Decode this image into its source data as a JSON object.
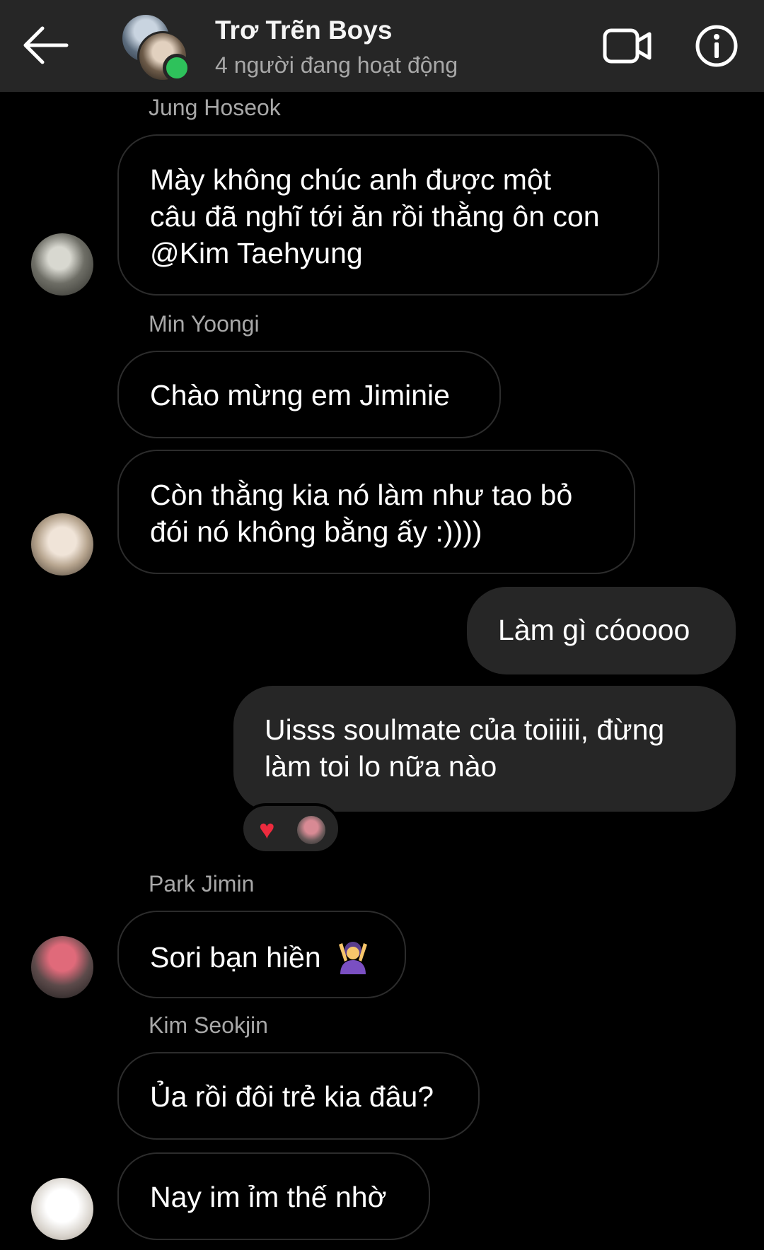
{
  "header": {
    "group_name": "Trơ Trẽn Boys",
    "status": "4 người đang hoạt động"
  },
  "messages": [
    {
      "sender": "Jung Hoseok",
      "text": "Mày không chúc anh được một\ncâu đã nghĩ tới ăn rồi thằng ôn con\n@Kim Taehyung"
    },
    {
      "sender": "Min Yoongi",
      "text": "Chào mừng em Jiminie"
    },
    {
      "text": "Còn thằng kia nó làm như tao bỏ\nđói nó không bằng ấy :))))"
    },
    {
      "text": "Làm gì cóoooo"
    },
    {
      "text": "Uisss soulmate của toiiiii, đừng\nlàm toi lo nữa nào",
      "reactions": [
        "heart"
      ]
    },
    {
      "sender": "Park Jimin",
      "text": "Sori bạn hiền",
      "emoji": "woman-raising-hand-emoji"
    },
    {
      "sender": "Kim Seokjin",
      "text": "Ủa rồi đôi trẻ kia đâu?"
    },
    {
      "text": "Nay im ỉm thế nhờ"
    }
  ],
  "colors": {
    "background": "#000000",
    "header": "#262626",
    "outgoing_bubble": "#262626",
    "online": "#2ec25b",
    "heart": "#ed2b3e"
  }
}
